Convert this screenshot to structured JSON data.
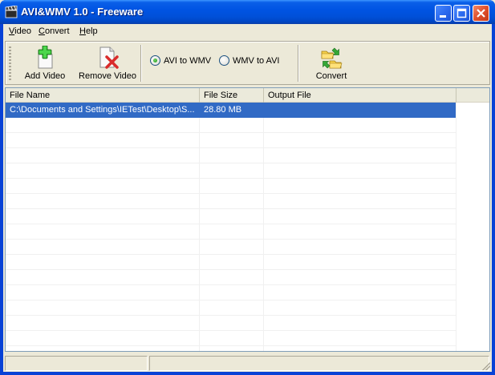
{
  "window": {
    "title": "AVI&WMV 1.0 - Freeware"
  },
  "menu": {
    "items": [
      {
        "label": "Video",
        "key": "V",
        "rest": "ideo"
      },
      {
        "label": "Convert",
        "key": "C",
        "rest": "onvert"
      },
      {
        "label": "Help",
        "key": "H",
        "rest": "elp"
      }
    ]
  },
  "toolbar": {
    "add_video_label": "Add Video",
    "remove_video_label": "Remove Video",
    "avi_to_wmv_label": "AVI to WMV",
    "wmv_to_avi_label": "WMV to AVI",
    "convert_label": "Convert",
    "selected_mode": "AVI to WMV"
  },
  "list": {
    "columns": [
      "File Name",
      "File Size",
      "Output File"
    ],
    "rows": [
      {
        "file_name": "C:\\Documents and Settings\\IETest\\Desktop\\S...",
        "file_size": "28.80 MB",
        "output_file": "",
        "selected": true
      }
    ]
  },
  "colors": {
    "selection": "#316ac5",
    "titlebar": "#0054e3",
    "close_button": "#e0502c"
  },
  "icons": {
    "title": "video-clapper-icon",
    "add": "add-video-icon",
    "remove": "remove-video-icon",
    "convert": "convert-folders-icon"
  }
}
